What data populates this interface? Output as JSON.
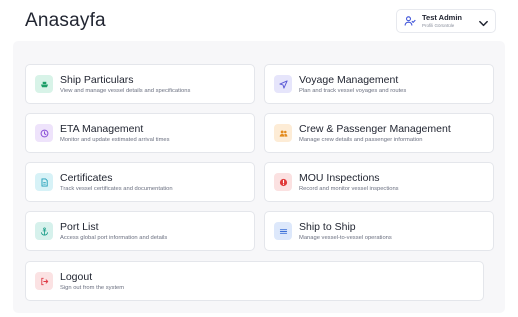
{
  "header": {
    "title": "Anasayfa"
  },
  "user": {
    "name": "Test Admin",
    "role": "Profili Görüntüle",
    "icon": "user-check-icon"
  },
  "colors": {
    "green_bg": "#d8f3e8",
    "green_fg": "#1e9e68",
    "violet_bg": "#e6e5fb",
    "violet_fg": "#5b5ad6",
    "purple_bg": "#eee3fb",
    "purple_fg": "#8a4fd8",
    "orange_bg": "#fdecd6",
    "orange_fg": "#e38a1c",
    "cyan_bg": "#d7f2f7",
    "cyan_fg": "#1f9fb8",
    "red_bg": "#fbe1e1",
    "red_fg": "#e03a3a",
    "teal_bg": "#d6f1ec",
    "teal_fg": "#169b86",
    "blue_bg": "#dde8fb",
    "blue_fg": "#3b6fd8",
    "rose_bg": "#fbe2e3",
    "rose_fg": "#df3b46"
  },
  "menu": [
    {
      "title": "Ship Particulars",
      "desc": "View and manage vessel details and specifications",
      "icon": "ship-icon"
    },
    {
      "title": "Voyage Management",
      "desc": "Plan and track vessel voyages and routes",
      "icon": "navigation-icon"
    },
    {
      "title": "ETA Management",
      "desc": "Monitor and update estimated arrival times",
      "icon": "clock-icon"
    },
    {
      "title": "Crew & Passenger Management",
      "desc": "Manage crew details and passenger information",
      "icon": "users-icon"
    },
    {
      "title": "Certificates",
      "desc": "Track vessel certificates and documentation",
      "icon": "document-icon"
    },
    {
      "title": "MOU Inspections",
      "desc": "Record and monitor vessel inspections",
      "icon": "alert-icon"
    },
    {
      "title": "Port List",
      "desc": "Access global port information and details",
      "icon": "anchor-icon"
    },
    {
      "title": "Ship to Ship",
      "desc": "Manage vessel-to-vessel operations",
      "icon": "list-icon"
    },
    {
      "title": "Logout",
      "desc": "Sign out from the system",
      "icon": "logout-icon"
    }
  ]
}
